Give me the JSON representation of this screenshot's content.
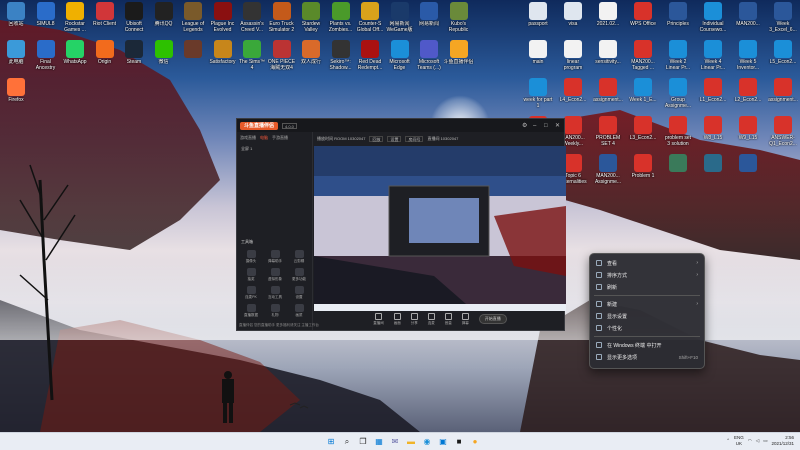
{
  "desktop": {
    "icons_left": [
      {
        "label": "回收站",
        "icon": "recycle-bin-icon",
        "color": "#3b82c4"
      },
      {
        "label": "SIMUL8",
        "icon": "simul8-icon",
        "color": "#2a6cc9"
      },
      {
        "label": "Rockstar Games ...",
        "icon": "rockstar-icon",
        "color": "#f0b000"
      },
      {
        "label": "Riot Client",
        "icon": "riot-icon",
        "color": "#d13639"
      },
      {
        "label": "Ubisoft Connect",
        "icon": "ubisoft-icon",
        "color": "#1b1b1b"
      },
      {
        "label": "腾讯QQ",
        "icon": "qq-icon",
        "color": "#222"
      },
      {
        "label": "League of Legends",
        "icon": "lol-icon",
        "color": "#7a5a2a"
      },
      {
        "label": "Plague Inc Evolved",
        "icon": "plague-icon",
        "color": "#8a1010"
      },
      {
        "label": "Assassin's Creed V...",
        "icon": "assassins-icon",
        "color": "#333"
      },
      {
        "label": "Euro Truck Simulator 2",
        "icon": "euro-truck-icon",
        "color": "#c45a1a"
      },
      {
        "label": "Stardew Valley",
        "icon": "stardew-icon",
        "color": "#5a8a2a"
      },
      {
        "label": "Plants vs. Zombies...",
        "icon": "pvz-icon",
        "color": "#4a9a2a"
      },
      {
        "label": "Counter-S Global Off...",
        "icon": "csgo-icon",
        "color": "#d9a21b"
      },
      {
        "label": "网易新闻 WeGame版",
        "icon": "wegame-icon",
        "color": "#1a3a6a"
      },
      {
        "label": "网易新闻",
        "icon": "news-icon",
        "color": "#2a5aa8"
      },
      {
        "label": "Kubo's Republic",
        "icon": "kubo-icon",
        "color": "#6a8a3a"
      },
      {
        "label": "此电脑",
        "icon": "this-pc-icon",
        "color": "#3b9ad9"
      },
      {
        "label": "Final Ancestry",
        "icon": "simul8-2-icon",
        "color": "#2a6cc9"
      },
      {
        "label": "WhatsApp",
        "icon": "whatsapp-icon",
        "color": "#25d366"
      },
      {
        "label": "Origin",
        "icon": "origin-icon",
        "color": "#f26b1d"
      },
      {
        "label": "Steam",
        "icon": "steam-icon",
        "color": "#1b2838"
      },
      {
        "label": "微信",
        "icon": "wechat-icon",
        "color": "#2dc100"
      },
      {
        "label": "",
        "icon": "game-icon",
        "color": "#6a3a2a"
      },
      {
        "label": "Satisfactory",
        "icon": "satisfactory-icon",
        "color": "#c7861b"
      },
      {
        "label": "The Sims™ 4",
        "icon": "sims-icon",
        "color": "#3aa83a"
      },
      {
        "label": "ONE PIECE 海贼无双4",
        "icon": "onepiece-icon",
        "color": "#b33"
      },
      {
        "label": "双人成行",
        "icon": "ittakestwo-icon",
        "color": "#d96a2a"
      },
      {
        "label": "Sekiro™: Shadow...",
        "icon": "sekiro-icon",
        "color": "#333"
      },
      {
        "label": "Red Dead Redempt...",
        "icon": "rdr-icon",
        "color": "#a11"
      },
      {
        "label": "Microsoft Edge",
        "icon": "edge-icon",
        "color": "#1b8fd8"
      },
      {
        "label": "Microsoft Teams (...)",
        "icon": "teams-icon",
        "color": "#5059c9"
      },
      {
        "label": "斗鱼直播伴侣",
        "icon": "douyu-icon",
        "color": "#f5a623"
      },
      {
        "label": "Firefox",
        "icon": "firefox-icon",
        "color": "#ff7139"
      }
    ],
    "icons_right": [
      {
        "label": "passport",
        "icon": "folder-icon",
        "color": "#dfe6ef"
      },
      {
        "label": "visa",
        "icon": "folder-icon",
        "color": "#dfe6ef"
      },
      {
        "label": "2021.02...",
        "icon": "file-icon",
        "color": "#f2f2f2"
      },
      {
        "label": "WPS Office",
        "icon": "wps-icon",
        "color": "#d8322a"
      },
      {
        "label": "Principles",
        "icon": "word-icon",
        "color": "#2b579a"
      },
      {
        "label": "Individual Coursewo...",
        "icon": "edge-icon",
        "color": "#1b8fd8"
      },
      {
        "label": "MAN200...",
        "icon": "word-icon",
        "color": "#2b579a"
      },
      {
        "label": "Week 3_Excel_6...",
        "icon": "word-icon",
        "color": "#2b579a"
      },
      {
        "label": "main",
        "icon": "doc-icon",
        "color": "#f2f2f2"
      },
      {
        "label": "linear program",
        "icon": "doc-icon",
        "color": "#f2f2f2"
      },
      {
        "label": "sensitivity...",
        "icon": "doc-icon",
        "color": "#f2f2f2"
      },
      {
        "label": "MAN200... Tagged ...",
        "icon": "pdf-icon",
        "color": "#d8322a"
      },
      {
        "label": "Week 2 Linear Pr...",
        "icon": "edge-icon",
        "color": "#1b8fd8"
      },
      {
        "label": "Week 4 Linear Pr...",
        "icon": "edge-icon",
        "color": "#1b8fd8"
      },
      {
        "label": "Week 5 Inventor...",
        "icon": "edge-icon",
        "color": "#1b8fd8"
      },
      {
        "label": "L5_Econ2...",
        "icon": "edge-icon",
        "color": "#1b8fd8"
      },
      {
        "label": "week for part 1",
        "icon": "edge-icon",
        "color": "#1b8fd8"
      },
      {
        "label": "L4_Econ2...",
        "icon": "pdf-icon",
        "color": "#d8322a"
      },
      {
        "label": "assignment...",
        "icon": "pdf-icon",
        "color": "#d8322a"
      },
      {
        "label": "Week 1_E...",
        "icon": "edge-icon",
        "color": "#1b8fd8"
      },
      {
        "label": "Group Assignme...",
        "icon": "edge-icon",
        "color": "#1b8fd8"
      },
      {
        "label": "L1_Econ2...",
        "icon": "pdf-icon",
        "color": "#d8322a"
      },
      {
        "label": "L2_Econ2...",
        "icon": "pdf-icon",
        "color": "#d8322a"
      },
      {
        "label": "assignment...",
        "icon": "pdf-icon",
        "color": "#d8322a"
      },
      {
        "label": "Weekly Lecture ...",
        "icon": "pdf-icon",
        "color": "#d8322a"
      },
      {
        "label": "MAN200... Weekly...",
        "icon": "pdf-icon",
        "color": "#d8322a"
      },
      {
        "label": "PROBLEM SET 4",
        "icon": "pdf-icon",
        "color": "#d8322a"
      },
      {
        "label": "L3_Econ2...",
        "icon": "pdf-icon",
        "color": "#d8322a"
      },
      {
        "label": "problem set 3 solution",
        "icon": "pdf-icon",
        "color": "#d8322a"
      },
      {
        "label": "W8_L15",
        "icon": "pdf-icon",
        "color": "#d8322a"
      },
      {
        "label": "W9_L15",
        "icon": "pdf-icon",
        "color": "#d8322a"
      },
      {
        "label": "ANSWER-Q1_Econ2...",
        "icon": "pdf-icon",
        "color": "#d8322a"
      },
      {
        "label": "LJ_Econ2...",
        "icon": "pdf-icon",
        "color": "#d8322a"
      },
      {
        "label": "Topic 6 Externalities",
        "icon": "pdf-icon",
        "color": "#d8322a"
      },
      {
        "label": "MAN200... Assignme...",
        "icon": "word-icon",
        "color": "#2b579a"
      },
      {
        "label": "Problem 1",
        "icon": "pdf-icon",
        "color": "#d8322a"
      },
      {
        "label": "",
        "icon": "image-icon",
        "color": "#3a7a5a"
      },
      {
        "label": "",
        "icon": "image-icon",
        "color": "#2a6a8a"
      },
      {
        "label": "",
        "icon": "word-icon",
        "color": "#2b579a"
      }
    ]
  },
  "app_window": {
    "logo_text": "斗鱼直播伴侣",
    "version": "4.0.0",
    "tabs": [
      "游戏直播",
      "电脑",
      "手游直播"
    ],
    "scene_label": "全屏 1",
    "stream_title": "播放时间 ROOM 10302047",
    "chips": [
      "回放",
      "设置",
      "房间号"
    ],
    "stream_status": "直播间 10302047",
    "section_label": "工具箱",
    "tools": [
      {
        "label": "摄像头"
      },
      {
        "label": "弹幕助手"
      },
      {
        "label": "云剪辑"
      },
      {
        "label": "抽奖"
      },
      {
        "label": "虚拟形象"
      },
      {
        "label": "更多功能"
      },
      {
        "label": "连麦PK"
      },
      {
        "label": "互动工具"
      },
      {
        "label": "设置"
      },
      {
        "label": "直播数据"
      },
      {
        "label": "礼物"
      },
      {
        "label": "画质"
      }
    ],
    "bottom_buttons": [
      {
        "label": "直播间"
      },
      {
        "label": "画面"
      },
      {
        "label": "分享"
      },
      {
        "label": "连麦"
      },
      {
        "label": "音量"
      },
      {
        "label": "弹幕"
      }
    ],
    "record_label": "开始直播",
    "footer_text": "直播伴侣 您的直播助手 更多福利请关注 主播工作台 "
  },
  "context_menu": {
    "items": [
      {
        "label": "查看",
        "icon": "view-icon",
        "submenu": true
      },
      {
        "label": "排序方式",
        "icon": "sort-icon",
        "submenu": true
      },
      {
        "label": "刷新",
        "icon": "refresh-icon",
        "submenu": false
      },
      {
        "label": "新建",
        "icon": "new-icon",
        "submenu": true
      },
      {
        "label": "显示设置",
        "icon": "display-icon",
        "submenu": false
      },
      {
        "label": "个性化",
        "icon": "personalize-icon",
        "submenu": false
      },
      {
        "label": "在 Windows 终端 中打开",
        "icon": "terminal-icon",
        "submenu": false
      },
      {
        "label": "显示更多选项",
        "icon": "more-icon",
        "submenu": false,
        "shortcut": "Shift+F10"
      }
    ]
  },
  "taskbar": {
    "apps": [
      {
        "icon": "windows-start-icon",
        "color": "#0078d4"
      },
      {
        "icon": "search-icon",
        "color": "#222"
      },
      {
        "icon": "task-view-icon",
        "color": "#222"
      },
      {
        "icon": "widgets-icon",
        "color": "#0078d4"
      },
      {
        "icon": "chat-icon",
        "color": "#6264a7"
      },
      {
        "icon": "file-explorer-icon",
        "color": "#f0b429"
      },
      {
        "icon": "edge-icon",
        "color": "#1b8fd8"
      },
      {
        "icon": "store-icon",
        "color": "#0078d4"
      },
      {
        "icon": "app-icon",
        "color": "#1b1b1b"
      },
      {
        "icon": "douyu-icon",
        "color": "#f5a623"
      }
    ],
    "lang_top": "ENG",
    "lang_bottom": "UK",
    "time": "2:56",
    "date": "2021/12/31"
  }
}
